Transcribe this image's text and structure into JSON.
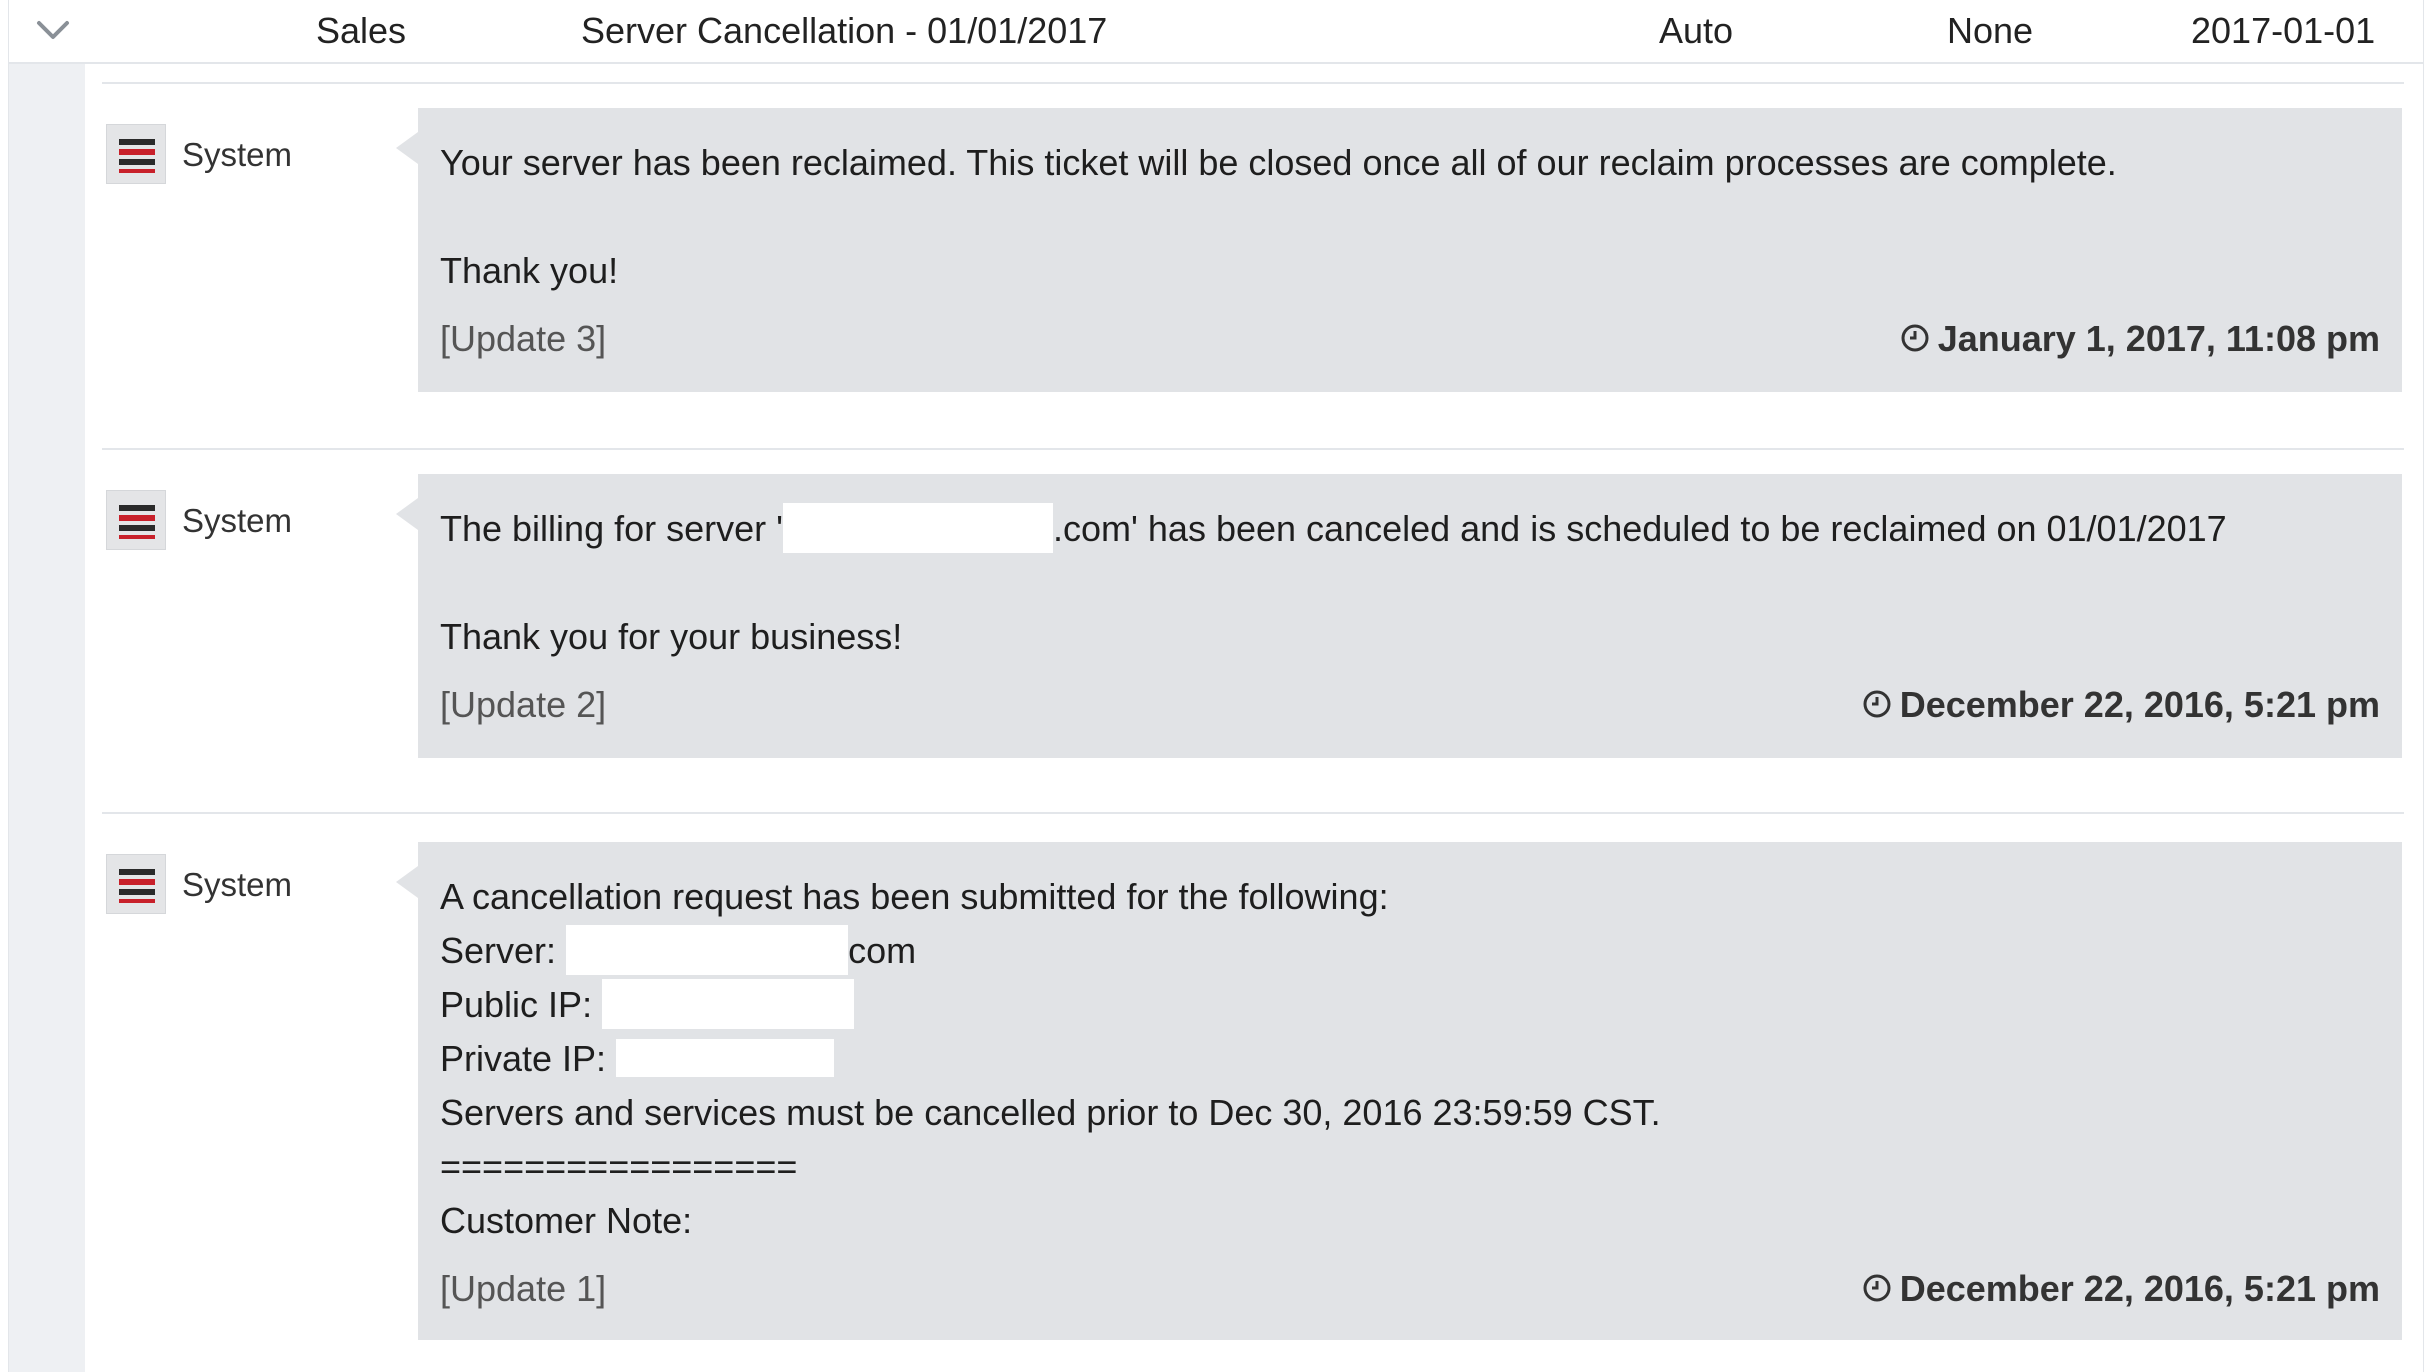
{
  "header": {
    "department": "Sales",
    "subject": "Server Cancellation - 01/01/2017",
    "assignment": "Auto",
    "priority": "None",
    "date": "2017-01-01"
  },
  "colors": {
    "avatar_stripe_red": "#c8202a",
    "avatar_stripe_dark": "#2a2a2a",
    "bubble_bg": "#e1e3e6"
  },
  "updates": [
    {
      "author": "System",
      "lines": [
        "Your server has been reclaimed. This ticket will be closed once all of our reclaim processes are complete.",
        "Thank you!"
      ],
      "update_label": "[Update 3]",
      "timestamp": "January 1, 2017, 11:08 pm"
    },
    {
      "author": "System",
      "line1_prefix": "The billing for server '",
      "line1_suffix": ".com' has been canceled and is scheduled to be reclaimed on 01/01/2017",
      "line2": "Thank you for your business!",
      "update_label": "[Update 2]",
      "timestamp": "December 22, 2016, 5:21 pm"
    },
    {
      "author": "System",
      "intro": "A cancellation request has been submitted for the following:",
      "server_label": "Server:",
      "server_suffix": "com",
      "public_ip_label": "Public IP:",
      "private_ip_label": "Private IP:",
      "deadline": "Servers and services must be cancelled prior to Dec 30, 2016 23:59:59 CST.",
      "divider": "=================",
      "customer_note": "Customer Note:",
      "update_label": "[Update 1]",
      "timestamp": "December 22, 2016, 5:21 pm"
    }
  ]
}
